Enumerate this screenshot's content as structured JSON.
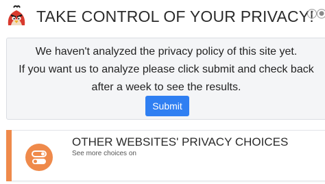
{
  "header": {
    "title": "TAKE CONTROL OF YOUR PRIVACY!",
    "help_icon": "help-icon",
    "chat_icon": "chat-icon",
    "logo_icon": "angry-bird-logo"
  },
  "info": {
    "line1": "We haven't analyzed the privacy policy of this site yet.",
    "line2": "If you want us to analyze please click submit and check back",
    "line3": "after a week to see the results.",
    "submit_label": "Submit"
  },
  "choices": {
    "title": "OTHER WEBSITES' PRIVACY CHOICES",
    "subtitle": "See more choices on",
    "icon": "toggle-icon"
  },
  "colors": {
    "accent": "#ef8a4b",
    "primary_button": "#2f7ff2",
    "panel_bg": "#f4f5f7"
  }
}
